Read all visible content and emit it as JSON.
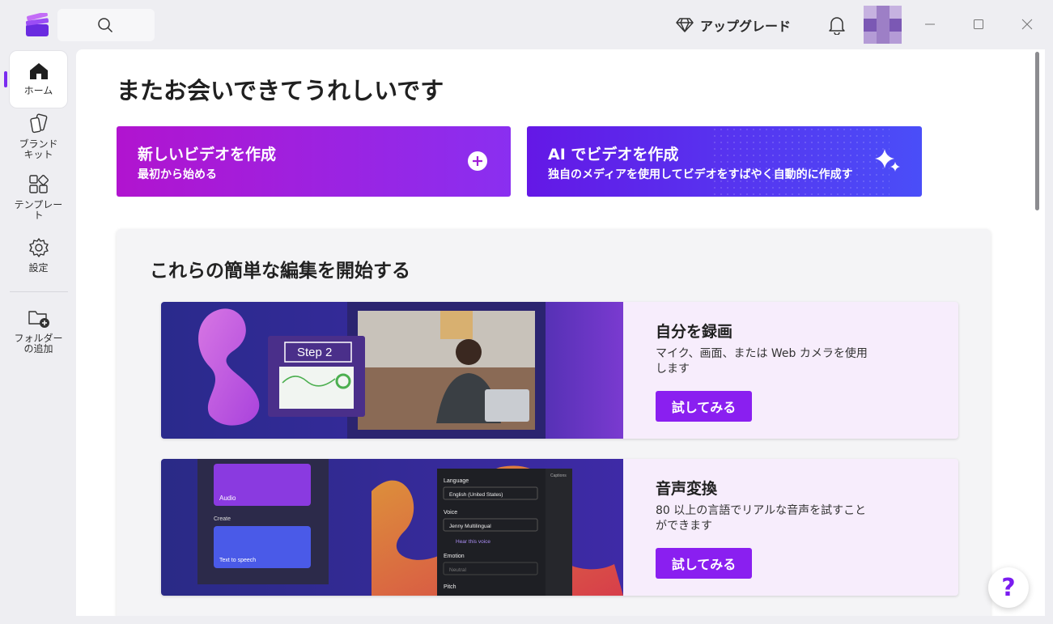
{
  "header": {
    "upgrade_label": "アップグレード"
  },
  "sidebar": {
    "items": [
      {
        "label": "ホーム",
        "icon": "home-icon",
        "active": true
      },
      {
        "label": "ブランド\nキット",
        "icon": "brand-kit-icon"
      },
      {
        "label": "テンプレー\nト",
        "icon": "templates-icon"
      },
      {
        "label": "設定",
        "icon": "gear-icon"
      },
      {
        "label": "フォルダー\nの追加",
        "icon": "folder-add-icon"
      }
    ]
  },
  "main": {
    "title": "またお会いできてうれしいです",
    "cta_new": {
      "title": "新しいビデオを作成",
      "subtitle": "最初から始める"
    },
    "cta_ai": {
      "title": "AI でビデオを作成",
      "subtitle": "独自のメディアを使用してビデオをすばやく自動的に作成す"
    },
    "section_title": "これらの簡単な編集を開始する",
    "cards": [
      {
        "title": "自分を録画",
        "description": "マイク、画面、または Web カメラを使用します",
        "button": "試してみる",
        "image_text": "Step 2"
      },
      {
        "title": "音声変換",
        "description": "80 以上の言語でリアルな音声を試すことができます",
        "button": "試してみる",
        "panel": {
          "language_label": "Language",
          "language_value": "English (United States)",
          "voice_label": "Voice",
          "voice_value": "Jenny Multilingual",
          "hear_voice": "Hear this voice",
          "emotion_label": "Emotion",
          "emotion_value": "Neutral",
          "pitch_label": "Pitch",
          "captions_tab": "Captions",
          "tts_tab": "Text to speech",
          "audio_tile": "Audio",
          "create_label": "Create",
          "tts_tile": "Text to speech"
        }
      }
    ]
  },
  "help_label": "?",
  "colors": {
    "accent": "#8a1ff0",
    "cta_new_start": "#b114cf",
    "cta_ai_end": "#4a4ef8"
  }
}
